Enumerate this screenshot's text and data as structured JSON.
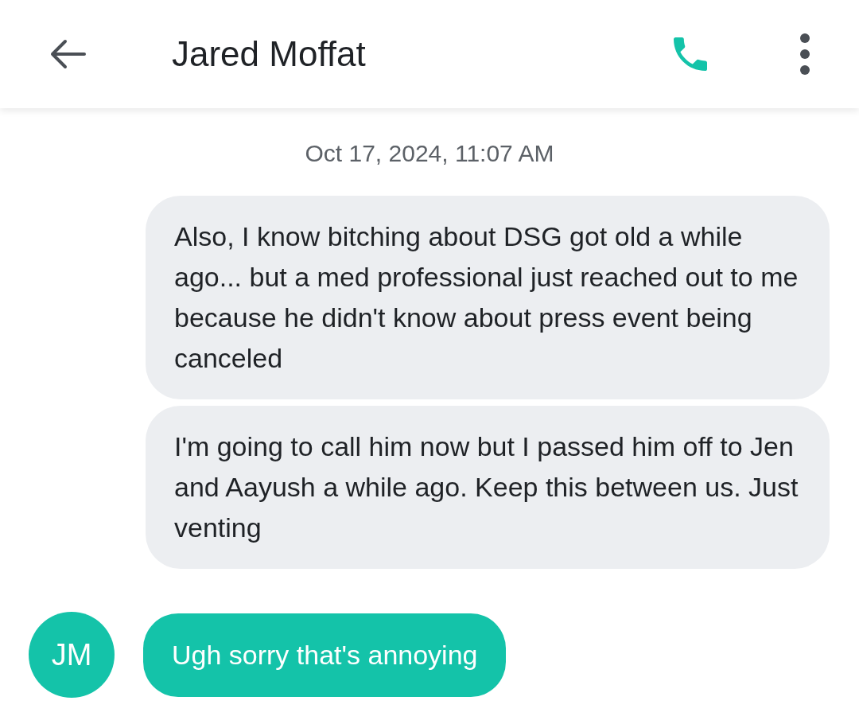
{
  "header": {
    "title": "Jared Moffat"
  },
  "timestamp": "Oct 17, 2024, 11:07 AM",
  "messages": [
    {
      "kind": "outgoing",
      "text": "Also, I know bitching about DSG got old a while ago... but a med professional just reached out to me because he didn't know about press event being canceled"
    },
    {
      "kind": "outgoing",
      "text": "I'm going to call him now but I passed him off to Jen and Aayush a while ago. Keep this between us. Just venting"
    },
    {
      "kind": "incoming",
      "avatar": "JM",
      "text": "Ugh sorry that's annoying"
    }
  ]
}
